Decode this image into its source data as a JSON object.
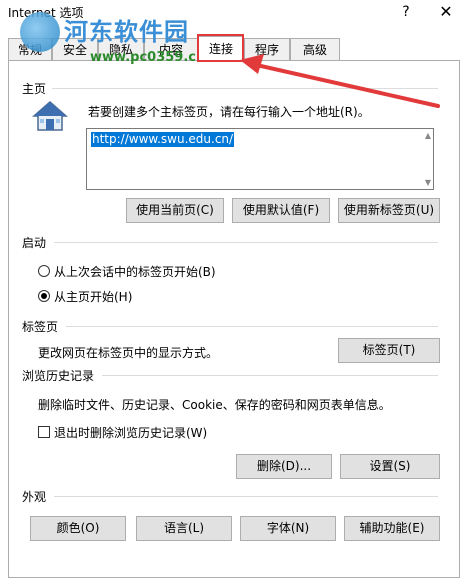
{
  "window": {
    "title": "Internet 选项",
    "help": "?",
    "close": "✕"
  },
  "watermark": {
    "site_name": "河东软件园",
    "url": "www.pc0359.cn"
  },
  "tabs": [
    {
      "label": "常规"
    },
    {
      "label": "安全"
    },
    {
      "label": "隐私"
    },
    {
      "label": "内容"
    },
    {
      "label": "连接"
    },
    {
      "label": "程序"
    },
    {
      "label": "高级"
    }
  ],
  "homepage": {
    "heading": "主页",
    "instruction": "若要创建多个主标签页，请在每行输入一个地址(R)。",
    "url": "http://www.swu.edu.cn/",
    "use_current": "使用当前页(C)",
    "use_default": "使用默认值(F)",
    "use_new_tab": "使用新标签页(U)"
  },
  "startup": {
    "heading": "启动",
    "option1": "从上次会话中的标签页开始(B)",
    "option2": "从主页开始(H)",
    "selected": "option2"
  },
  "tabs_section": {
    "heading": "标签页",
    "description": "更改网页在标签页中的显示方式。",
    "button": "标签页(T)"
  },
  "history": {
    "heading": "浏览历史记录",
    "description": "删除临时文件、历史记录、Cookie、保存的密码和网页表单信息。",
    "checkbox_label": "退出时删除浏览历史记录(W)",
    "delete": "删除(D)...",
    "settings": "设置(S)"
  },
  "appearance": {
    "heading": "外观",
    "colors": "颜色(O)",
    "languages": "语言(L)",
    "fonts": "字体(N)",
    "accessibility": "辅助功能(E)"
  },
  "colors": {
    "highlight": "#e23a3a",
    "selection": "#0078d7"
  }
}
